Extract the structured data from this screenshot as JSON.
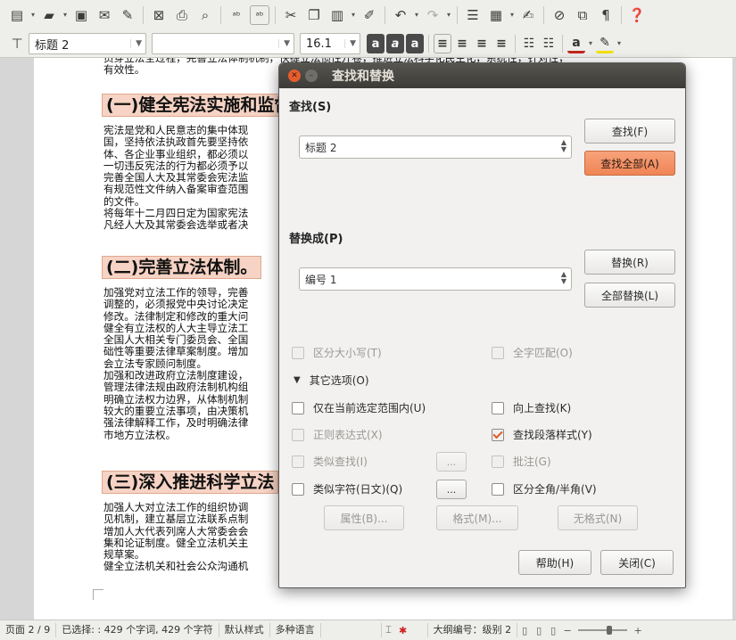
{
  "toolbar": {
    "paragraph_style": "标题 2",
    "font_name": "",
    "font_size": "16.1",
    "icons": [
      "document-icon",
      "open-icon",
      "save-icon",
      "email-icon",
      "edit-icon",
      "pdf-icon",
      "print-icon",
      "print-preview-icon",
      "spellcheck-icon",
      "autospell-icon",
      "cut-icon",
      "copy-icon",
      "paste-icon",
      "clone-icon",
      "undo-icon",
      "redo-icon",
      "navigator-icon",
      "table-icon",
      "draw-icon",
      "chart-icon",
      "textbox-icon",
      "pilcrow-icon",
      "help-icon"
    ]
  },
  "document": {
    "top_text": "员穿立法全过程，完善立法体制机制，快捷立法惯性开卷，推进立法科学化民主化，系统性，针对性，\n有效性。",
    "headings": [
      "(一)健全宪法实施和监督",
      "(二)完善立法体制。",
      "(三)深入推进科学立法"
    ],
    "para1": "宪法是党和人民意志的集中体现\n国，坚持依法执政首先要坚持依\n体、各企业事业组织，都必须以\n一切违反宪法的行为都必须予以\n完善全国人大及其常委会宪法监\n有规范性文件纳入备案审查范围\n的文件。\n将每年十二月四日定为国家宪法\n凡经人大及其常委会选举或者决",
    "para2": "加强党对立法工作的领导，完善\n调整的，必须报党中央讨论决定\n修改。法律制定和修改的重大问\n健全有立法权的人大主导立法工\n全国人大相关专门委员会、全国\n础性等重要法律草案制度。增加\n会立法专家顾问制度。\n加强和改进政府立法制度建设，\n管理法律法规由政府法制机构组\n明确立法权力边界，从体制机制\n较大的重要立法事项，由决策机\n强法律解释工作，及时明确法律\n市地方立法权。",
    "para3": "加强人大对立法工作的组织协调\n见机制，建立基层立法联系点制\n增加人大代表列席人大常委会会\n集和论证制度。健全立法机关主\n规草案。\n健全立法机关和社会公众沟通机"
  },
  "statusbar": {
    "page": "页面 2 / 9",
    "selection": "已选择: : 429 个字词, 429 个字符",
    "page_style": "默认样式",
    "language": "多种语言",
    "outline": "大纲编号：级别 2"
  },
  "dialog": {
    "title": "查找和替换",
    "find_label": "查找(S)",
    "find_value": "标题 2",
    "find_button": "查找(F)",
    "find_all_button": "查找全部(A)",
    "replace_label": "替换成(P)",
    "replace_value": "编号 1",
    "replace_button": "替换(R)",
    "replace_all_button": "全部替换(L)",
    "match_case": "区分大小写(T)",
    "whole_words": "全字匹配(O)",
    "other_options": "其它选项(O)",
    "current_selection": "仅在当前选定范围内(U)",
    "backwards": "向上查找(K)",
    "regex": "正则表达式(X)",
    "paragraph_styles": "查找段落样式(Y)",
    "similarity": "类似查找(I)",
    "comments": "批注(G)",
    "sounds_like": "类似字符(日文)(Q)",
    "half_full_width": "区分全角/半角(V)",
    "ellipsis": "...",
    "attributes_button": "属性(B)...",
    "format_button": "格式(M)...",
    "no_format_button": "无格式(N)",
    "help_button": "帮助(H)",
    "close_button": "关闭(C)"
  }
}
